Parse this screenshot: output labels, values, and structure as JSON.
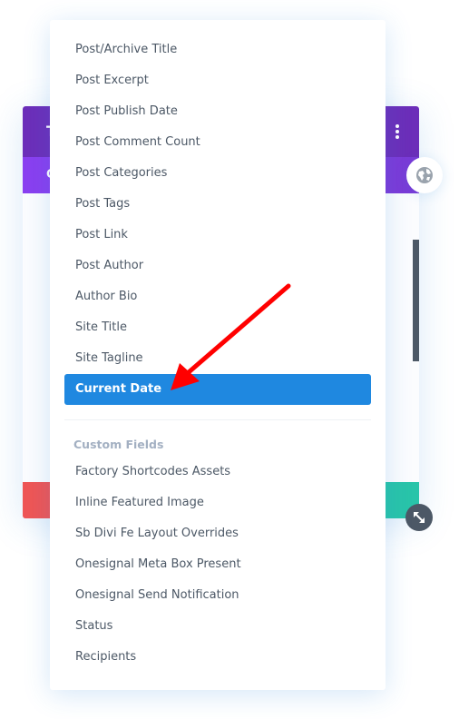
{
  "background_modal": {
    "header_title": "T",
    "tab_label": "C",
    "more_options_icon": "vertical-dots-icon",
    "globe_icon": "globe-icon",
    "resize_icon": "resize-arrows-icon",
    "colors": {
      "header": "#6c2eb9",
      "tabs": "#8a3ff0",
      "cancel": "#ef5555",
      "save": "#29c4a9",
      "scrollbar": "#4c5866"
    }
  },
  "menu": {
    "items": [
      {
        "label": "Post/Archive Title"
      },
      {
        "label": "Post Excerpt"
      },
      {
        "label": "Post Publish Date"
      },
      {
        "label": "Post Comment Count"
      },
      {
        "label": "Post Categories"
      },
      {
        "label": "Post Tags"
      },
      {
        "label": "Post Link"
      },
      {
        "label": "Post Author"
      },
      {
        "label": "Author Bio"
      },
      {
        "label": "Site Title"
      },
      {
        "label": "Site Tagline"
      },
      {
        "label": "Current Date",
        "selected": true
      }
    ],
    "group_label": "Custom Fields",
    "custom_fields": [
      {
        "label": "Factory Shortcodes Assets"
      },
      {
        "label": "Inline Featured Image"
      },
      {
        "label": "Sb Divi Fe Layout Overrides"
      },
      {
        "label": "Onesignal Meta Box Present"
      },
      {
        "label": "Onesignal Send Notification"
      },
      {
        "label": "Status"
      },
      {
        "label": "Recipients"
      }
    ],
    "selected_color": "#1f88e0"
  },
  "annotation": {
    "type": "red-arrow",
    "points_to": "Current Date",
    "color": "#ff0000"
  }
}
